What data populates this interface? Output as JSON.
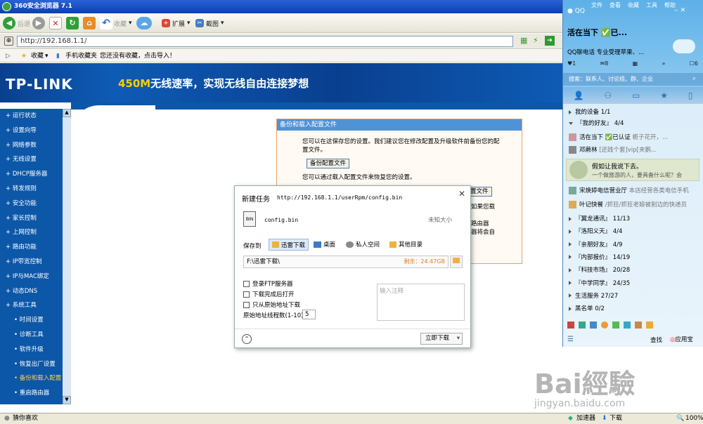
{
  "browser": {
    "title": "360安全浏览器 7.1",
    "back_label": "后退",
    "forward_label": "前进",
    "favorites_label": "收藏",
    "extend_label": "扩展",
    "screenshot_label": "截图",
    "url": "http://192.168.1.1/",
    "fav_label": "收藏",
    "mobile_fav": "手机收藏夹",
    "fav_hint": "您还没有收藏，点击导入！"
  },
  "banner": {
    "logo": "TP-LINK",
    "speed": "450M",
    "slogan": "无线速率，实现无线自由连接梦想"
  },
  "menu": [
    {
      "label": "运行状态",
      "sub": false,
      "active": false
    },
    {
      "label": "设置向导",
      "sub": false,
      "active": false
    },
    {
      "label": "网络参数",
      "sub": false,
      "active": false
    },
    {
      "label": "无线设置",
      "sub": false,
      "active": false
    },
    {
      "label": "DHCP服务器",
      "sub": false,
      "active": false
    },
    {
      "label": "转发规则",
      "sub": false,
      "active": false
    },
    {
      "label": "安全功能",
      "sub": false,
      "active": false
    },
    {
      "label": "家长控制",
      "sub": false,
      "active": false
    },
    {
      "label": "上网控制",
      "sub": false,
      "active": false
    },
    {
      "label": "路由功能",
      "sub": false,
      "active": false
    },
    {
      "label": "IP带宽控制",
      "sub": false,
      "active": false
    },
    {
      "label": "IP与MAC绑定",
      "sub": false,
      "active": false
    },
    {
      "label": "动态DNS",
      "sub": false,
      "active": false
    },
    {
      "label": "系统工具",
      "sub": false,
      "active": false
    },
    {
      "label": "时间设置",
      "sub": true,
      "active": false
    },
    {
      "label": "诊断工具",
      "sub": true,
      "active": false
    },
    {
      "label": "软件升级",
      "sub": true,
      "active": false
    },
    {
      "label": "恢复出厂设置",
      "sub": true,
      "active": false
    },
    {
      "label": "备份和载入配置",
      "sub": true,
      "active": true
    },
    {
      "label": "重启路由器",
      "sub": true,
      "active": false
    }
  ],
  "panel": {
    "title": "备份和载入配置文件",
    "line1": "您可以在这保存您的设置。我们建议您在修改配置及升级软件前备份您的配",
    "line1b": "置文件。",
    "backup_btn": "备份配置文件",
    "line2": "您可以通过载入配置文件来恢复您的设置。",
    "load_btn": "置文件",
    "r1": "如果您载",
    "r2": "路由器",
    "r3": "器将会自"
  },
  "dialog": {
    "title": "新建任务",
    "url": "http://192.168.1.1/userRpm/config.bin",
    "filename": "config.bin",
    "size": "未知大小",
    "save_to": "保存到",
    "opt1": "迅雷下载",
    "opt2": "桌面",
    "opt3": "私人空间",
    "opt4": "其他目录",
    "path": "F:\\迅雷下载\\",
    "remaining": "剩余：24.47GB",
    "chk1": "登录FTP服务器",
    "chk2": "下载完成后打开",
    "chk3": "只从原始地址下载",
    "threads_label": "原始地址线程数(1-10)",
    "threads_value": "5",
    "note_placeholder": "输入注释",
    "download_btn": "立即下载"
  },
  "qq": {
    "title": "QQ",
    "menu": [
      "文件",
      "查看",
      "收藏",
      "工具",
      "帮助"
    ],
    "nick": "活在当下 ✅已...",
    "status": "QQ聊电话 专业受理苹果、...",
    "counts": [
      "1",
      "8",
      "6"
    ],
    "search_placeholder": "搜索：联系人、讨论组、群、企业",
    "groups": [
      {
        "label": "我的设备 1/1"
      },
      {
        "label": "『我的好友』 4/4"
      }
    ],
    "friend1": "活在当下 ✅已认证",
    "friend1_sig": "栀子花开，...",
    "friend2": "邓蕨林",
    "friend2_sig": "[还践个套]vip[夹鹅...",
    "ad_title": "假如让我说下去。",
    "ad_sub": "一个做旅游的人，要具备什么呢？会",
    "friend3": "宋焕婷电信营业厅",
    "friend3_sig": "本店经营各类电信手机",
    "friend4": "叶记快餐",
    "friend4_sig": "/抓狂/抓狂老娘被割边的快递员",
    "groups2": [
      {
        "label": "『翼龙通讯』 11/13"
      },
      {
        "label": "『洛阳义天』 4/4"
      },
      {
        "label": "『亲朋好友』 4/9"
      },
      {
        "label": "『内部报价』 14/19"
      },
      {
        "label": "『科技市场』 20/28"
      },
      {
        "label": "『中学同学』 24/35"
      },
      {
        "label": "生活服务 27/27"
      },
      {
        "label": "黑名单 0/2"
      }
    ],
    "find": "查找",
    "appstore": "应用宝"
  },
  "status": {
    "left": "猜你喜欢",
    "accel": "加速器",
    "download": "下载",
    "zoom": "100%"
  },
  "watermark": {
    "text": "Bai經驗",
    "sub": "jingyan.baidu.com"
  }
}
